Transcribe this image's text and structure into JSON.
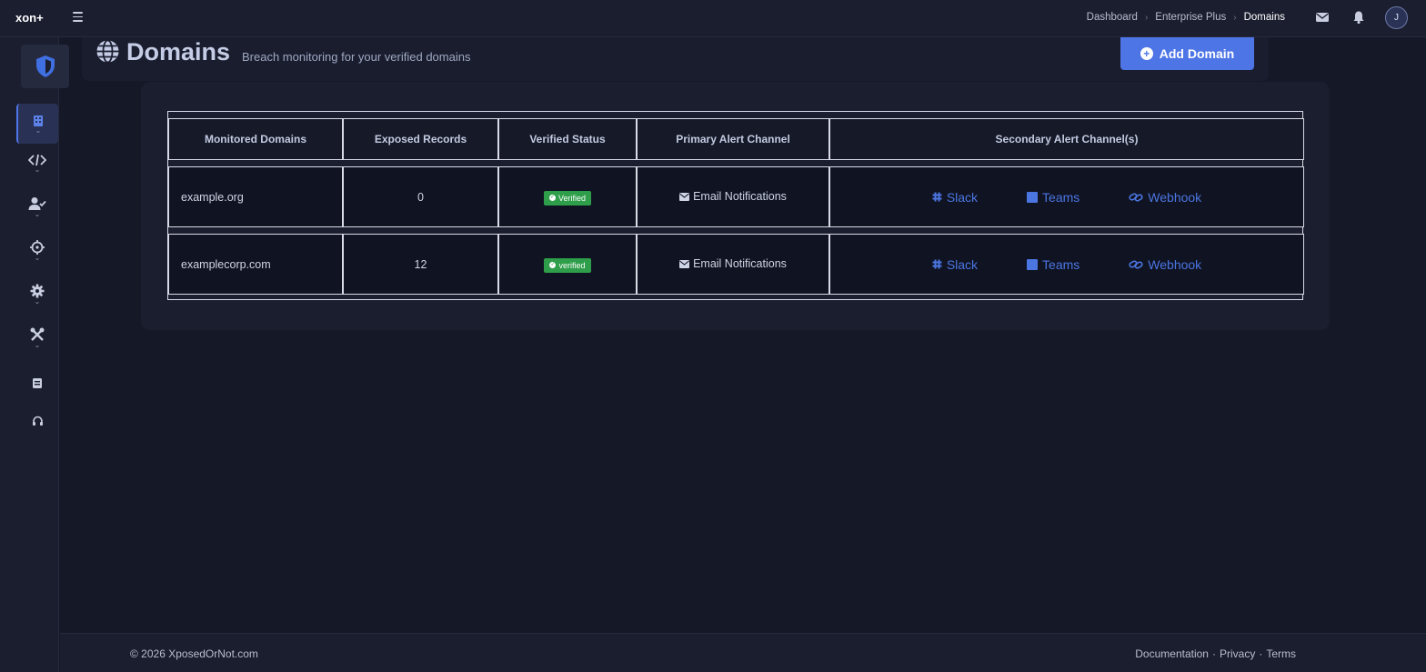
{
  "app": {
    "brand": "xon+"
  },
  "breadcrumb": [
    "Dashboard",
    "Enterprise Plus",
    "Domains"
  ],
  "user": {
    "avatar_initial": "J"
  },
  "sidebar": {
    "items": [
      {
        "icon": "building-icon",
        "active": true
      },
      {
        "icon": "code-icon",
        "active": false
      },
      {
        "icon": "user-check-icon",
        "active": false
      },
      {
        "icon": "crosshair-icon",
        "active": false
      },
      {
        "icon": "gear-icon",
        "active": false
      },
      {
        "icon": "tools-icon",
        "active": false
      },
      {
        "icon": "book-icon",
        "active": false
      },
      {
        "icon": "headset-icon",
        "active": false
      }
    ]
  },
  "header": {
    "title": "Domains",
    "subtitle": "Breach monitoring for your verified domains",
    "add_button": "Add Domain"
  },
  "table": {
    "columns": [
      "Monitored Domains",
      "Exposed Records",
      "Verified Status",
      "Primary Alert Channel",
      "Secondary Alert Channel(s)"
    ],
    "rows": [
      {
        "domain": "example.org",
        "exposed": "0",
        "status": "Verified",
        "primary": "Email Notifications",
        "secondary": [
          "Slack",
          "Teams",
          "Webhook"
        ]
      },
      {
        "domain": "examplecorp.com",
        "exposed": "12",
        "status": "verified",
        "primary": "Email Notifications",
        "secondary": [
          "Slack",
          "Teams",
          "Webhook"
        ]
      }
    ]
  },
  "footer": {
    "copyright_prefix": "© 2026 ",
    "copyright_link": "XposedOrNot.com",
    "links": [
      "Documentation",
      "Privacy",
      "Terms"
    ],
    "separator": "·"
  },
  "colors": {
    "accent": "#4e75e6",
    "success": "#2e9e4a",
    "background": "#151827"
  }
}
